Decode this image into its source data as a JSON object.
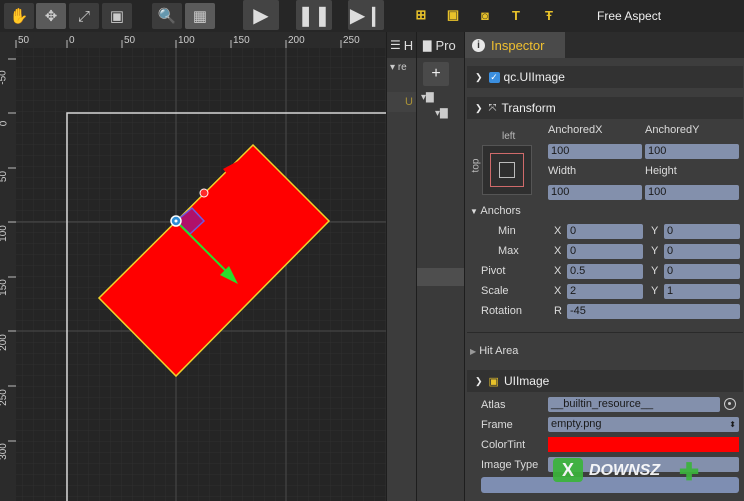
{
  "toolbar": {
    "tools": [
      "hand-tool",
      "move-tool",
      "scale-tool",
      "rect-tool"
    ],
    "aspect": "Free Aspect"
  },
  "scene": {
    "ruler_top": [
      "50",
      "0",
      "50",
      "100",
      "150",
      "200",
      "250"
    ],
    "ruler_left": [
      "-50",
      "0",
      "50",
      "100",
      "150",
      "200",
      "250",
      "300"
    ]
  },
  "hierarchy": {
    "tab": "H",
    "item": "re",
    "item2": "U"
  },
  "project": {
    "tab": "Pro",
    "add": "+"
  },
  "inspector": {
    "tab": "Inspector",
    "component_name": "qc.UIImage",
    "transform": {
      "title": "Transform",
      "anchor_preset_h": "left",
      "anchor_preset_v": "top",
      "anchored_x_label": "AnchoredX",
      "anchored_x": "100",
      "anchored_y_label": "AnchoredY",
      "anchored_y": "100",
      "width_label": "Width",
      "width": "100",
      "height_label": "Height",
      "height": "100",
      "anchors_label": "Anchors",
      "min_label": "Min",
      "min_x": "0",
      "min_y": "0",
      "max_label": "Max",
      "max_x": "0",
      "max_y": "0",
      "pivot_label": "Pivot",
      "pivot_x": "0.5",
      "pivot_y": "0",
      "scale_label": "Scale",
      "scale_x": "2",
      "scale_y": "1",
      "rotation_label": "Rotation",
      "rotation_r": "-45",
      "x": "X",
      "y": "Y",
      "r": "R"
    },
    "hit_area": "Hit Area",
    "uiimage": {
      "title": "UIImage",
      "atlas_label": "Atlas",
      "atlas": "__builtin_resource__",
      "frame_label": "Frame",
      "frame": "empty.png",
      "color_tint_label": "ColorTint",
      "color_tint": "#ff0000",
      "image_type_label": "Image Type"
    }
  },
  "watermark": "DOWNSZ"
}
